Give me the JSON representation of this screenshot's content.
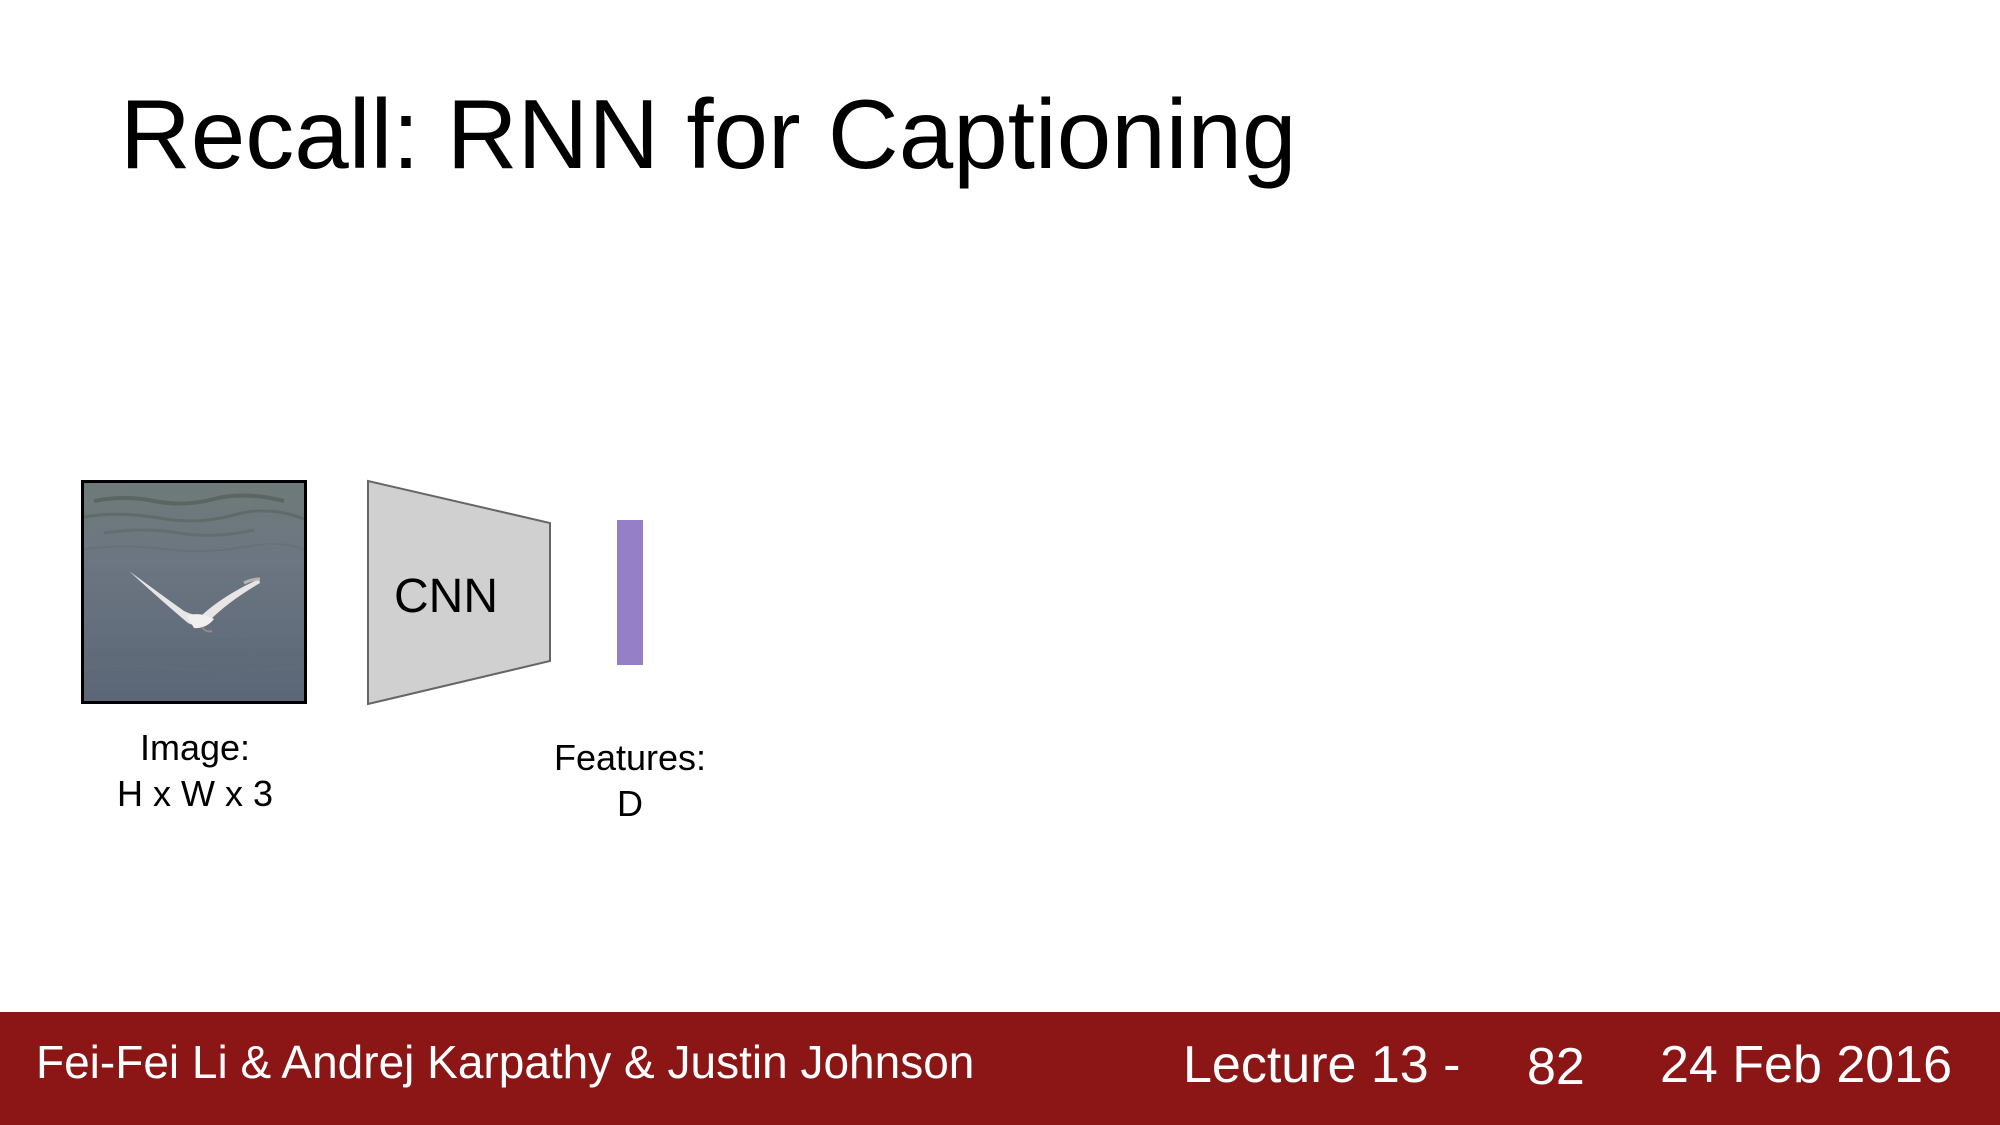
{
  "slide": {
    "title": "Recall: RNN for Captioning"
  },
  "diagram": {
    "image_label_line1": "Image:",
    "image_label_line2": "H x W x 3",
    "cnn_label": "CNN",
    "features_label_line1": "Features:",
    "features_label_line2": "D",
    "feature_color": "#9580c8",
    "cnn_fill": "#d0d0d0",
    "photo_icon": "seagull-photo"
  },
  "footer": {
    "authors": "Fei-Fei Li & Andrej Karpathy & Justin Johnson",
    "lecture": "Lecture 13 -",
    "page": "82",
    "date": "24 Feb 2016",
    "background_color": "#8c1515"
  }
}
